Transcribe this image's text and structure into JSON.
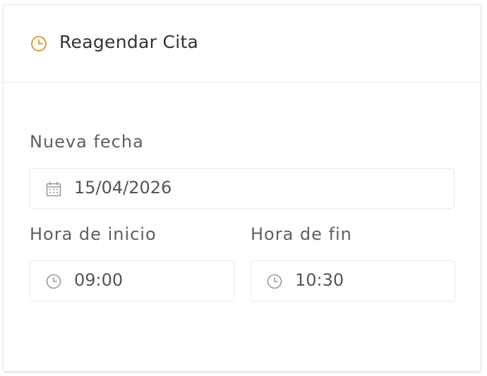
{
  "header": {
    "title": "Reagendar Cita",
    "icon": "clock-icon",
    "accent": "#e0a03a"
  },
  "form": {
    "date": {
      "label": "Nueva fecha",
      "value": "15/04/2026",
      "icon": "calendar-icon"
    },
    "start": {
      "label": "Hora de inicio",
      "value": "09:00",
      "icon": "clock-icon"
    },
    "end": {
      "label": "Hora de fin",
      "value": "10:30",
      "icon": "clock-icon"
    }
  }
}
